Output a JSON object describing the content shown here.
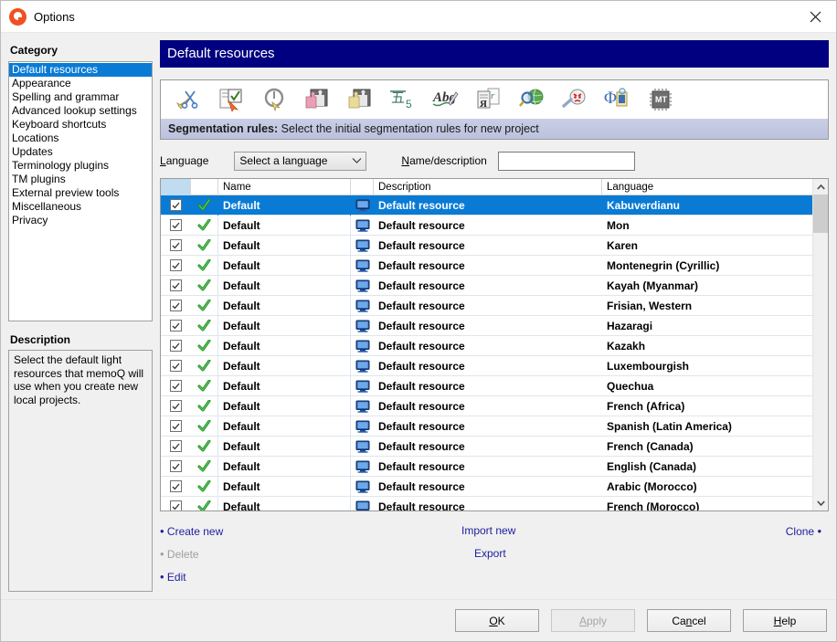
{
  "window": {
    "title": "Options",
    "logo_icon": "memoq-logo-icon",
    "close_icon": "close-icon"
  },
  "sidebar": {
    "category_heading": "Category",
    "items": [
      {
        "label": "Default resources",
        "selected": true
      },
      {
        "label": "Appearance",
        "selected": false
      },
      {
        "label": "Spelling and grammar",
        "selected": false
      },
      {
        "label": "Advanced lookup settings",
        "selected": false
      },
      {
        "label": "Keyboard shortcuts",
        "selected": false
      },
      {
        "label": "Locations",
        "selected": false
      },
      {
        "label": "Updates",
        "selected": false
      },
      {
        "label": "Terminology plugins",
        "selected": false
      },
      {
        "label": "TM plugins",
        "selected": false
      },
      {
        "label": "External preview tools",
        "selected": false
      },
      {
        "label": "Miscellaneous",
        "selected": false
      },
      {
        "label": "Privacy",
        "selected": false
      }
    ],
    "description_heading": "Description",
    "description_text": "Select the default light resources that memoQ will use when you create new local projects."
  },
  "main": {
    "page_title": "Default resources",
    "toolbar": {
      "icons": [
        {
          "name": "segmentation-rules-icon",
          "selected": true
        },
        {
          "name": "qa-settings-icon",
          "selected": false
        },
        {
          "name": "auto-translation-rules-icon",
          "selected": false
        },
        {
          "name": "pink-puzzle-icon",
          "selected": false
        },
        {
          "name": "yellow-puzzle-icon",
          "selected": false
        },
        {
          "name": "non-translatables-icon",
          "selected": false
        },
        {
          "name": "auto-correct-icon",
          "selected": false
        },
        {
          "name": "font-substitution-icon",
          "selected": false
        },
        {
          "name": "web-search-settings-icon",
          "selected": false
        },
        {
          "name": "qa-angry-face-icon",
          "selected": false
        },
        {
          "name": "livedocs-icon",
          "selected": false
        },
        {
          "name": "mt-settings-icon",
          "selected": false
        }
      ],
      "hint_label": "Segmentation rules:",
      "hint_text": "Select the initial segmentation rules for new project"
    },
    "filters": {
      "language_label": "Language",
      "language_value": "Select a language",
      "language_chevron": "chevron-down-icon",
      "namedesc_label": "Name/description",
      "namedesc_value": "",
      "namedesc_placeholder": ""
    },
    "table": {
      "columns": [
        "",
        "",
        "Name",
        "",
        "Description",
        "Language"
      ],
      "headers": {
        "name": "Name",
        "description": "Description",
        "language": "Language"
      },
      "rows": [
        {
          "checked": true,
          "valid": true,
          "name": "Default",
          "icon": "local-resource-icon",
          "description": "Default resource",
          "language": "Kabuverdianu",
          "selected": true
        },
        {
          "checked": true,
          "valid": true,
          "name": "Default",
          "icon": "local-resource-icon",
          "description": "Default resource",
          "language": "Mon",
          "selected": false
        },
        {
          "checked": true,
          "valid": true,
          "name": "Default",
          "icon": "local-resource-icon",
          "description": "Default resource",
          "language": "Karen",
          "selected": false
        },
        {
          "checked": true,
          "valid": true,
          "name": "Default",
          "icon": "local-resource-icon",
          "description": "Default resource",
          "language": "Montenegrin (Cyrillic)",
          "selected": false
        },
        {
          "checked": true,
          "valid": true,
          "name": "Default",
          "icon": "local-resource-icon",
          "description": "Default resource",
          "language": "Kayah (Myanmar)",
          "selected": false
        },
        {
          "checked": true,
          "valid": true,
          "name": "Default",
          "icon": "local-resource-icon",
          "description": "Default resource",
          "language": "Frisian, Western",
          "selected": false
        },
        {
          "checked": true,
          "valid": true,
          "name": "Default",
          "icon": "local-resource-icon",
          "description": "Default resource",
          "language": "Hazaragi",
          "selected": false
        },
        {
          "checked": true,
          "valid": true,
          "name": "Default",
          "icon": "local-resource-icon",
          "description": "Default resource",
          "language": "Kazakh",
          "selected": false
        },
        {
          "checked": true,
          "valid": true,
          "name": "Default",
          "icon": "local-resource-icon",
          "description": "Default resource",
          "language": "Luxembourgish",
          "selected": false
        },
        {
          "checked": true,
          "valid": true,
          "name": "Default",
          "icon": "local-resource-icon",
          "description": "Default resource",
          "language": "Quechua",
          "selected": false
        },
        {
          "checked": true,
          "valid": true,
          "name": "Default",
          "icon": "local-resource-icon",
          "description": "Default resource",
          "language": "French (Africa)",
          "selected": false
        },
        {
          "checked": true,
          "valid": true,
          "name": "Default",
          "icon": "local-resource-icon",
          "description": "Default resource",
          "language": "Spanish (Latin America)",
          "selected": false
        },
        {
          "checked": true,
          "valid": true,
          "name": "Default",
          "icon": "local-resource-icon",
          "description": "Default resource",
          "language": "French (Canada)",
          "selected": false
        },
        {
          "checked": true,
          "valid": true,
          "name": "Default",
          "icon": "local-resource-icon",
          "description": "Default resource",
          "language": "English (Canada)",
          "selected": false
        },
        {
          "checked": true,
          "valid": true,
          "name": "Default",
          "icon": "local-resource-icon",
          "description": "Default resource",
          "language": "Arabic (Morocco)",
          "selected": false
        },
        {
          "checked": true,
          "valid": true,
          "name": "Default",
          "icon": "local-resource-icon",
          "description": "Default resource",
          "language": "French (Morocco)",
          "selected": false
        }
      ],
      "scrollbar": {
        "up_icon": "chevron-up-icon",
        "down_icon": "chevron-down-icon"
      }
    },
    "actions": {
      "create_new": "Create new",
      "delete": "Delete",
      "delete_disabled": true,
      "edit": "Edit",
      "import_new": "Import new",
      "export": "Export",
      "clone": "Clone"
    }
  },
  "footer": {
    "buttons": [
      {
        "label": "OK",
        "accel": "O",
        "disabled": false,
        "name": "ok-button"
      },
      {
        "label": "Apply",
        "accel": "A",
        "disabled": true,
        "name": "apply-button"
      },
      {
        "label": "Cancel",
        "accel": "n",
        "disabled": false,
        "name": "cancel-button"
      },
      {
        "label": "Help",
        "accel": "H",
        "disabled": false,
        "name": "help-button"
      }
    ]
  },
  "colors": {
    "header_bg": "#000080",
    "selection": "#0a7bd4",
    "link": "#2020a0",
    "logo": "#f05022",
    "hint_bar": "#c6cbe3"
  }
}
